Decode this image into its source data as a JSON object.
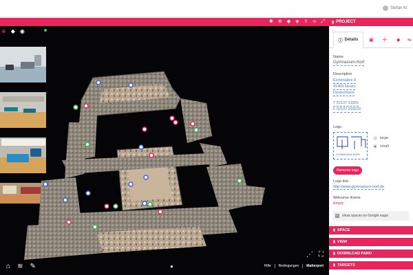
{
  "topbar": {
    "user_name": "Stefan Kr"
  },
  "toolbar": {
    "icons": [
      "settings-icon",
      "locate-icon",
      "tag-icon",
      "tags-icon",
      "share-icon",
      "link-icon",
      "expand-icon"
    ]
  },
  "viewer": {
    "tools": [
      "search-plus-icon",
      "tags-icon",
      "compass-icon"
    ],
    "bottom_links": {
      "help": "Hilfe",
      "conditions": "Bedingungen",
      "brand": "Matterport"
    }
  },
  "panel": {
    "header": "PROJECT",
    "tab_details": "Details",
    "name_label": "Name",
    "name_value": "Gymnasium-Norf",
    "description_label": "Description",
    "address": [
      "Eichenallee 8",
      "41469 Neuss",
      "Deutschland"
    ],
    "phone": "T  02137 91820",
    "fax": "F  02137 918229",
    "logo_label": "Logo",
    "logo_text": "GYMNASIUM NORF",
    "size_large": "large",
    "size_small": "small",
    "remove_logo": "Remove logo",
    "logo_link_label": "Logo link",
    "logo_link_value": "http://www.gymnasium-norf.de",
    "welcome_label": "Welcome iframe",
    "welcome_value": "Empty",
    "google_maps": "show spaces on Google maps"
  },
  "sections": [
    "SPACE",
    "VIEW",
    "DOWNLOAD PANO",
    "TARGETS"
  ],
  "colors": {
    "accent": "#e8265e",
    "viewer_bg": "#050507"
  }
}
